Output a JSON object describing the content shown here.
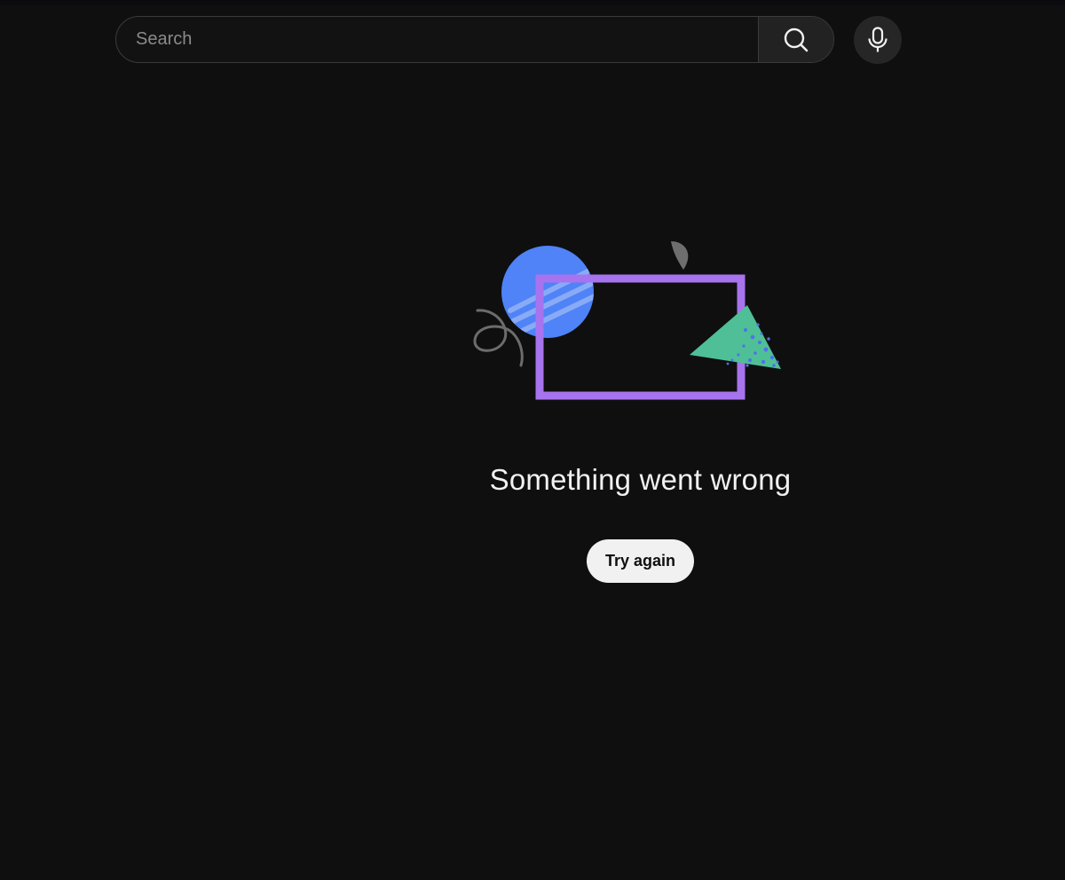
{
  "search": {
    "placeholder": "Search",
    "value": "",
    "button_icon": "search-icon"
  },
  "voice": {
    "icon": "microphone-icon"
  },
  "error": {
    "message": "Something went wrong",
    "retry_label": "Try again",
    "illustration": {
      "circle_color": "#4f83f7",
      "frame_color": "#a873ee",
      "triangle_color": "#4fbf97",
      "scribble_color": "#6c6c6c"
    }
  },
  "theme": {
    "background": "#0f0f10",
    "text": "#f1f1f1"
  }
}
